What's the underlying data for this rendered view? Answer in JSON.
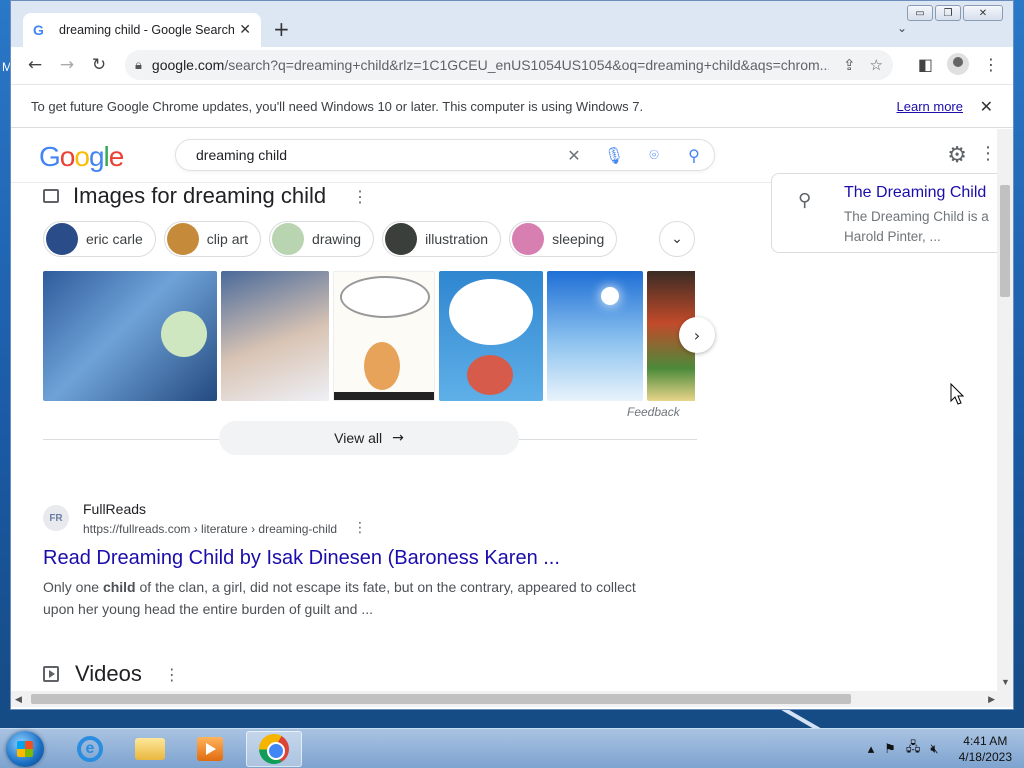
{
  "browser": {
    "tab_title": "dreaming child - Google Search",
    "url_host": "google.com",
    "url_path": "/search?q=dreaming+child&rlz=1C1GCEU_enUS1054US1054&oq=dreaming+child&aqs=chrom...",
    "infobar_text": "To get future Google Chrome updates, you'll need Windows 10 or later. This computer is using Windows 7.",
    "infobar_link": "Learn more"
  },
  "search": {
    "query": "dreaming child",
    "logo_letters": [
      "G",
      "o",
      "o",
      "g",
      "l",
      "e"
    ]
  },
  "images": {
    "heading": "Images for dreaming child",
    "chips": [
      {
        "label": "eric carle",
        "color": "#2a4d8a"
      },
      {
        "label": "clip art",
        "color": "#c58a3a"
      },
      {
        "label": "drawing",
        "color": "#b9d4b0"
      },
      {
        "label": "illustration",
        "color": "#3b3f3b"
      },
      {
        "label": "sleeping",
        "color": "#d77fb0"
      }
    ],
    "thumbnails": [
      {
        "name": "eric-carle-dream",
        "color": "#3d6fb3"
      },
      {
        "name": "sleeping-boy",
        "color": "#8ea7cc"
      },
      {
        "name": "cartoon-thought-bubble",
        "color": "#f7efe2"
      },
      {
        "name": "dream-cloud-bed",
        "color": "#3b8fd4"
      },
      {
        "name": "clouds-child",
        "color": "#2b7fd8"
      },
      {
        "name": "creating-souls",
        "color": "#5a4a3a"
      }
    ],
    "feedback": "Feedback",
    "view_all": "View all"
  },
  "result": {
    "site_name": "FullReads",
    "favicon_text": "FR",
    "cite": "https://fullreads.com › literature › dreaming-child",
    "title": "Read Dreaming Child by Isak Dinesen (Baroness Karen ...",
    "snippet_pre": "Only one ",
    "snippet_bold": "child",
    "snippet_post": " of the clan, a girl, did not escape its fate, but on the contrary, appeared to collect upon her young head the entire burden of guilt and ..."
  },
  "videos": {
    "heading": "Videos"
  },
  "knowledge_panel": {
    "title": "The Dreaming Child",
    "line1": "The Dreaming Child is a",
    "line2": "Harold Pinter, ..."
  },
  "taskbar": {
    "time": "4:41 AM",
    "date": "4/18/2023"
  },
  "desktop": {
    "edge_letter": "M"
  }
}
